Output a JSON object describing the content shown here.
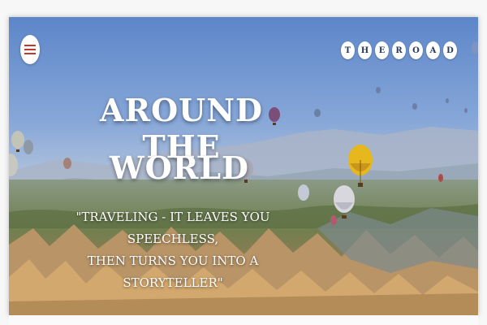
{
  "nav": {
    "menu_icon": "hamburger-menu-icon",
    "brand_letters": [
      "T",
      "H",
      "E",
      "R",
      "O",
      "A",
      "D"
    ]
  },
  "hero": {
    "title_line1": "AROUND THE",
    "title_line2": "WORLD",
    "quote_line1": "\"TRAVELING - IT LEAVES YOU SPEECHLESS,",
    "quote_line2": "THEN TURNS YOU INTO A STORYTELLER\""
  },
  "colors": {
    "menu_accent": "#c0392b",
    "brand_text": "#2a3b5a",
    "hero_text": "#ffffff"
  }
}
